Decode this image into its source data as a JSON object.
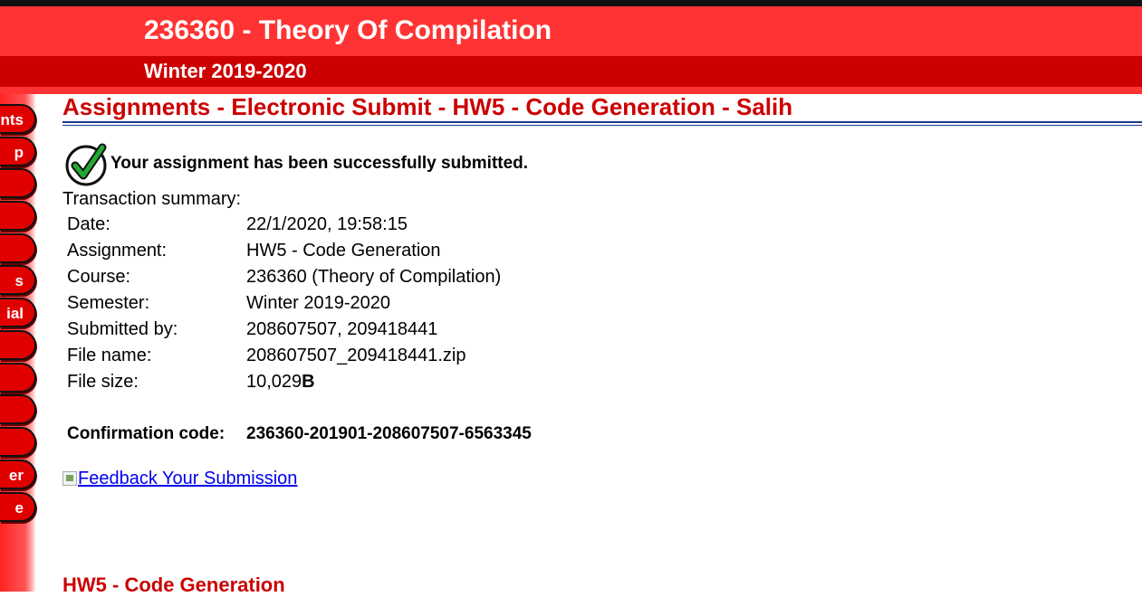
{
  "header": {
    "course_title": "236360 - Theory Of Compilation",
    "semester": "Winter 2019-2020"
  },
  "sidebar": {
    "tabs": [
      {
        "label": "nts"
      },
      {
        "label": "p"
      },
      {
        "label": ""
      },
      {
        "label": ""
      },
      {
        "label": ""
      },
      {
        "label": "s"
      },
      {
        "label": "ial"
      },
      {
        "label": ""
      },
      {
        "label": ""
      },
      {
        "label": ""
      },
      {
        "label": ""
      },
      {
        "label": "er"
      },
      {
        "label": "e"
      }
    ]
  },
  "main": {
    "heading": "Assignments - Electronic Submit - HW5 - Code Generation - Salih",
    "success_message": "Your assignment has been successfully submitted.",
    "summary_label": "Transaction summary:",
    "summary": {
      "date_label": "Date:",
      "date_value": "22/1/2020, 19:58:15",
      "assignment_label": "Assignment:",
      "assignment_value": "HW5 - Code Generation",
      "course_label": "Course:",
      "course_value": "236360 (Theory of Compilation)",
      "semester_label": "Semester:",
      "semester_value": "Winter 2019-2020",
      "submitted_by_label": "Submitted by:",
      "submitted_by_value": "208607507, 209418441",
      "file_name_label": "File name:",
      "file_name_value": "208607507_209418441.zip",
      "file_size_label": "File size:",
      "file_size_number": "10,029",
      "file_size_unit": "B"
    },
    "confirmation_label": "Confirmation code:",
    "confirmation_code": "236360-201901-208607507-6563345",
    "feedback_img_alt": "Feedback",
    "feedback_link_text": " Your Submission",
    "bottom_heading": "HW5 - Code Generation"
  },
  "colors": {
    "brand_red": "#ff3333",
    "dark_red": "#cc0000",
    "link_blue": "#0000ee",
    "rule_blue": "#1a3a8c"
  },
  "icons": {
    "success": "green-checkmark-icon",
    "feedback": "broken-image-icon"
  }
}
